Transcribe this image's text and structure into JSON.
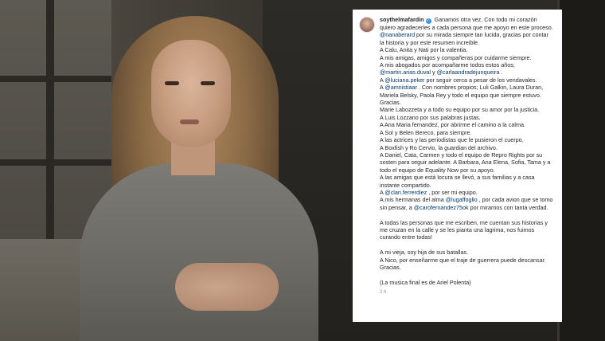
{
  "post": {
    "username": "soythelmafardin",
    "verified_icon": "verified-badge-icon",
    "lines": [
      "Ganamos otra vez. Con todo mi corazón quiero agradecerles a cada persona que me apoyo en este proceso.",
      [
        {
          "m": "@nanaberard"
        },
        {
          "t": " por su mirada siempre tan lucida, gracias por contar la historia y por este resumen increible."
        }
      ],
      "A Calu, Anita y Nati por la valentia.",
      "A mis amigas, amigos y compañeras por cuidarme siempre.",
      "A mis abogados por acompañarme todos estos años;",
      [
        {
          "m": "@martin.arias.duval"
        },
        {
          "t": " y "
        },
        {
          "m": "@carlaandradejunqueira"
        },
        {
          "t": " ."
        }
      ],
      [
        {
          "t": "A "
        },
        {
          "m": "@luciana.peker"
        },
        {
          "t": " por seguir cerca a pesar de los vendavales."
        }
      ],
      [
        {
          "t": "A "
        },
        {
          "m": "@amnistiaar"
        },
        {
          "t": " . Con nombres propios; Luli Galkin, Laura Duran, Mariela Belsky, Paola Rey y todo el equipo que siempre estuvo. Gracias."
        }
      ],
      "Marie Labozzeta y a todo su equipo por su amor por la justicia.",
      "A Luis Lozzano por sus palabras justas.",
      "A Ana Maria fernandez, por abrirme el camino a la calma.",
      "A Sol y Belen Bereco, para siempre.",
      "A las actrices y las periodistas que le pusieron el cuerpo.",
      "A Boxfish y Ro Cervio, la guardian del archivo.",
      "A Daniel, Cata, Carmen y todo el equipo de Repro Rights por su sosten para seguir adelante. A Barbara, Ana Elena, Sofia, Tama y a todo el equipo de Equality Now por su apoyo.",
      "A las amigas que está locura se llevó, a sus familias y a casa instante compartido.",
      [
        {
          "t": "A "
        },
        {
          "m": "@clari.ferrerdiez"
        },
        {
          "t": " , por ser mi equipo."
        }
      ],
      [
        {
          "t": "A mis hermanas del alma "
        },
        {
          "m": "@lugaffoglio"
        },
        {
          "t": " , por cada avion que se tomo sin pensar, a "
        },
        {
          "m": "@carofernandez75ok"
        },
        {
          "t": " por mirarnos con tanta verdad."
        }
      ],
      "",
      "A todas las personas que me escriben, me cuentan sus historias y me cruzan en la calle y se les pianta una lagrima, nos fuimos curando entre todas!",
      "",
      "A mi vieja, soy hija de sus batallas.",
      "A Nico, por enseñarme que el traje de guerrera puede descansar. Gracias.",
      "",
      "(La musica final es de Ariel Polenta)"
    ],
    "timestamp": "2 h"
  }
}
